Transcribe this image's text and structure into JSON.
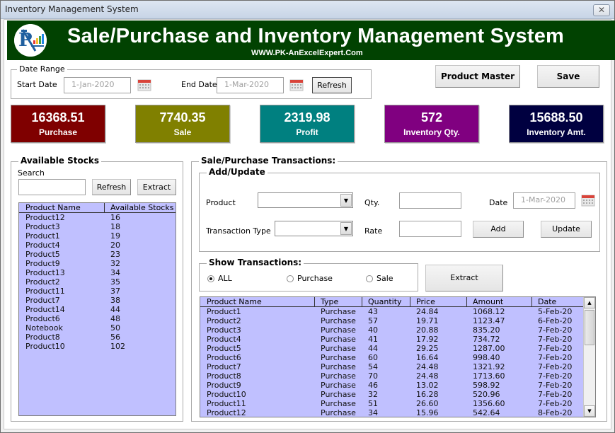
{
  "window": {
    "title": "Inventory Management System",
    "close_icon": "close-x-icon"
  },
  "banner": {
    "title": "Sale/Purchase and Inventory Management System",
    "subtitle": "WWW.PK-AnExcelExpert.Com",
    "logo": "pk-logo-icon",
    "background": "#014201"
  },
  "date_range": {
    "legend": "Date Range",
    "start_label": "Start Date",
    "start_value": "1-Jan-2020",
    "end_label": "End Date",
    "end_value": "1-Mar-2020",
    "calendar_icon": "calendar-icon",
    "refresh_label": "Refresh"
  },
  "toolbar": {
    "product_master_label": "Product Master",
    "save_label": "Save"
  },
  "cards": [
    {
      "value": "16368.51",
      "caption": "Purchase",
      "color": "#7f0000"
    },
    {
      "value": "7740.35",
      "caption": "Sale",
      "color": "#808000"
    },
    {
      "value": "2319.98",
      "caption": "Profit",
      "color": "#008080"
    },
    {
      "value": "572",
      "caption": "Inventory Qty.",
      "color": "#800080"
    },
    {
      "value": "15688.50",
      "caption": "Inventory Amt.",
      "color": "#000040"
    }
  ],
  "stocks": {
    "legend": "Available Stocks",
    "search_label": "Search",
    "search_value": "",
    "refresh_label": "Refresh",
    "extract_label": "Extract",
    "columns": [
      "Product Name",
      "Available Stocks"
    ],
    "rows": [
      [
        "Product12",
        "16"
      ],
      [
        "Product3",
        "18"
      ],
      [
        "Product1",
        "19"
      ],
      [
        "Product4",
        "20"
      ],
      [
        "Product5",
        "23"
      ],
      [
        "Product9",
        "32"
      ],
      [
        "Product13",
        "34"
      ],
      [
        "Product2",
        "35"
      ],
      [
        "Product11",
        "37"
      ],
      [
        "Product7",
        "38"
      ],
      [
        "Product14",
        "44"
      ],
      [
        "Product6",
        "48"
      ],
      [
        "Notebook",
        "50"
      ],
      [
        "Product8",
        "56"
      ],
      [
        "Product10",
        "102"
      ]
    ]
  },
  "transactions": {
    "legend": "Sale/Purchase Transactions:",
    "add_update": {
      "legend": "Add/Update",
      "product_label": "Product",
      "product_value": "",
      "qty_label": "Qty.",
      "qty_value": "",
      "date_label": "Date",
      "date_value": "1-Mar-2020",
      "type_label": "Transaction Type",
      "type_value": "",
      "rate_label": "Rate",
      "rate_value": "",
      "add_label": "Add",
      "update_label": "Update"
    },
    "show": {
      "legend": "Show Transactions:",
      "options": [
        {
          "label": "ALL",
          "selected": true
        },
        {
          "label": "Purchase",
          "selected": false
        },
        {
          "label": "Sale",
          "selected": false
        }
      ],
      "extract_label": "Extract"
    },
    "columns": [
      "Product Name",
      "Type",
      "Quantity",
      "Price",
      "Amount",
      "Date"
    ],
    "rows": [
      [
        "Product1",
        "Purchase",
        "43",
        "24.84",
        "1068.12",
        "5-Feb-20"
      ],
      [
        "Product2",
        "Purchase",
        "57",
        "19.71",
        "1123.47",
        "6-Feb-20"
      ],
      [
        "Product3",
        "Purchase",
        "40",
        "20.88",
        "835.20",
        "7-Feb-20"
      ],
      [
        "Product4",
        "Purchase",
        "41",
        "17.92",
        "734.72",
        "7-Feb-20"
      ],
      [
        "Product5",
        "Purchase",
        "44",
        "29.25",
        "1287.00",
        "7-Feb-20"
      ],
      [
        "Product6",
        "Purchase",
        "60",
        "16.64",
        "998.40",
        "7-Feb-20"
      ],
      [
        "Product7",
        "Purchase",
        "54",
        "24.48",
        "1321.92",
        "7-Feb-20"
      ],
      [
        "Product8",
        "Purchase",
        "70",
        "24.48",
        "1713.60",
        "7-Feb-20"
      ],
      [
        "Product9",
        "Purchase",
        "46",
        "13.02",
        "598.92",
        "7-Feb-20"
      ],
      [
        "Product10",
        "Purchase",
        "32",
        "16.28",
        "520.96",
        "7-Feb-20"
      ],
      [
        "Product11",
        "Purchase",
        "51",
        "26.60",
        "1356.60",
        "7-Feb-20"
      ],
      [
        "Product12",
        "Purchase",
        "34",
        "15.96",
        "542.64",
        "8-Feb-20"
      ]
    ]
  }
}
